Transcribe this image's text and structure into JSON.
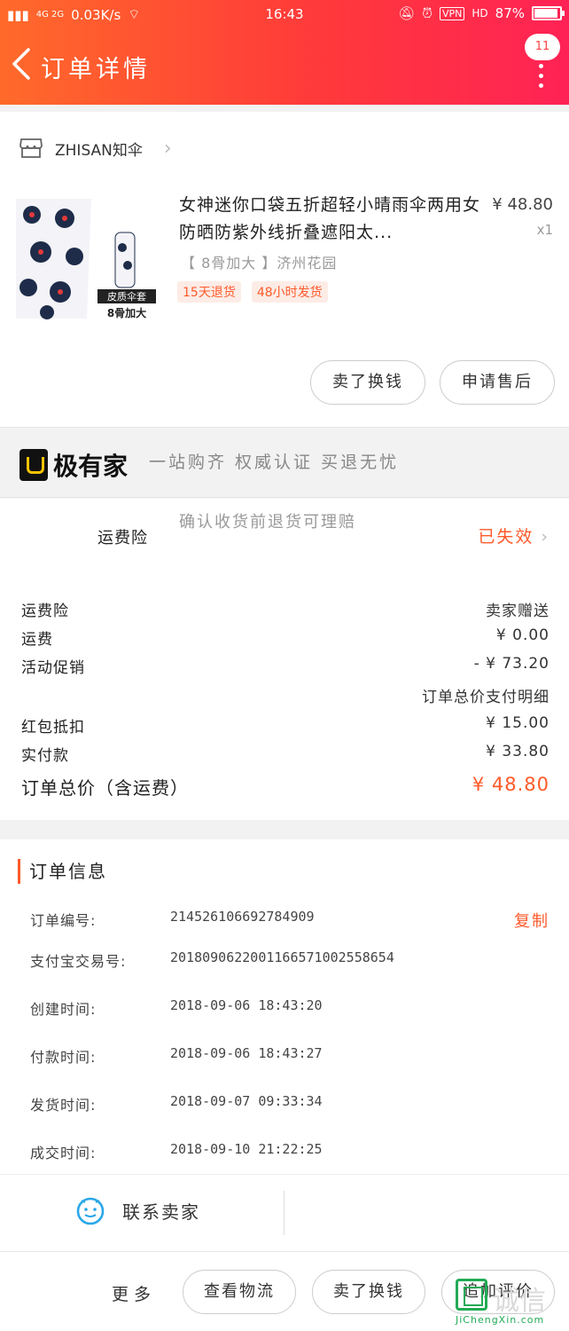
{
  "status_bar": {
    "network": "4G 2G",
    "speed": "0.03K/s",
    "time": "16:43",
    "vpn": "VPN",
    "hd": "HD",
    "battery": "87%",
    "battery_level": 0.87
  },
  "header": {
    "title": "订单详情",
    "badge": "11"
  },
  "store": {
    "name": "ZHISAN知伞"
  },
  "product": {
    "title": "女神迷你口袋五折超轻小晴雨伞两用女防晒防紫外线折叠遮阳太...",
    "price": "¥ 48.80",
    "qty": "x1",
    "sku": "【 8骨加大 】济州花园",
    "image_caption_top": "皮质伞套",
    "image_caption_bottom": "8骨加大",
    "tags": [
      "15天退货",
      "48小时发货"
    ]
  },
  "card_buttons": {
    "sell": "卖了换钱",
    "after_sale": "申请售后"
  },
  "banner": {
    "brand": "极有家",
    "slogan": "一站购齐 权威认证 买退无忧"
  },
  "insurance": {
    "label": "运费险",
    "desc": "确认收货前退货可理赔",
    "status": "已失效"
  },
  "price_rows": [
    {
      "label": "运费险",
      "value": "卖家赠送"
    },
    {
      "label": "运费",
      "value": "¥ 0.00"
    },
    {
      "label": "活动促销",
      "value": "- ¥ 73.20"
    },
    {
      "label": "",
      "value": "订单总价支付明细"
    },
    {
      "label": "红包抵扣",
      "value": "¥ 15.00"
    },
    {
      "label": "实付款",
      "value": "¥ 33.80"
    }
  ],
  "total": {
    "label": "订单总价（含运费）",
    "value": "¥ 48.80"
  },
  "order_info": {
    "heading": "订单信息",
    "copy": "复制",
    "rows": [
      {
        "key": "订单编号:",
        "value": "214526106692784909"
      },
      {
        "key": "支付宝交易号:",
        "value": "2018090622001166571002558654"
      },
      {
        "key": "创建时间:",
        "value": "2018-09-06 18:43:20"
      },
      {
        "key": "付款时间:",
        "value": "2018-09-06 18:43:27"
      },
      {
        "key": "发货时间:",
        "value": "2018-09-07 09:33:34"
      },
      {
        "key": "成交时间:",
        "value": "2018-09-10 21:22:25"
      }
    ],
    "contact": "联系卖家"
  },
  "bottom_bar": {
    "more": "更多",
    "logistics": "查看物流",
    "sell": "卖了换钱",
    "review": "追加评价"
  },
  "watermark": {
    "chars": "诚信",
    "url": "JiChengXin.com"
  },
  "colors": {
    "accent": "#ff5a2a",
    "header_start": "#ff6a2a",
    "header_end": "#ff2255"
  }
}
